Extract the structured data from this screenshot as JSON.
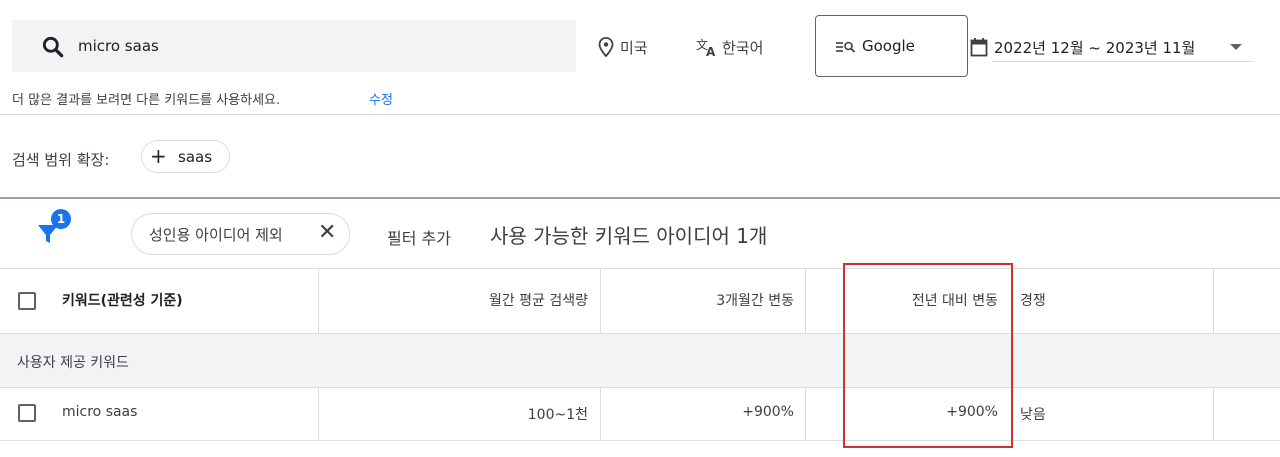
{
  "search": {
    "query": "micro saas"
  },
  "location": {
    "label": "미국"
  },
  "language": {
    "label": "한국어"
  },
  "network": {
    "label": "Google"
  },
  "date_range": {
    "label": "2022년 12월 ~ 2023년 11월"
  },
  "hint": {
    "text": "더 많은 결과를 보려면 다른 키워드를 사용하세요.",
    "link": "수정"
  },
  "expand": {
    "label": "검색 범위 확장:",
    "chip": "saas"
  },
  "filters": {
    "badge_count": "1",
    "active_chip": "성인용 아이디어 제외",
    "add_filter": "필터 추가",
    "ideas_count": "사용 가능한 키워드 아이디어 1개"
  },
  "table": {
    "headers": {
      "keyword": "키워드(관련성 기준)",
      "monthly": "월간 평균 검색량",
      "three_month": "3개월간 변동",
      "yoy": "전년 대비 변동",
      "competition": "경쟁"
    },
    "group_label": "사용자 제공 키워드",
    "rows": [
      {
        "keyword": "micro saas",
        "monthly": "100~1천",
        "three_month": "+900%",
        "yoy": "+900%",
        "competition": "낮음"
      }
    ]
  },
  "colors": {
    "accent": "#1a73e8",
    "highlight": "#d32f2f"
  }
}
